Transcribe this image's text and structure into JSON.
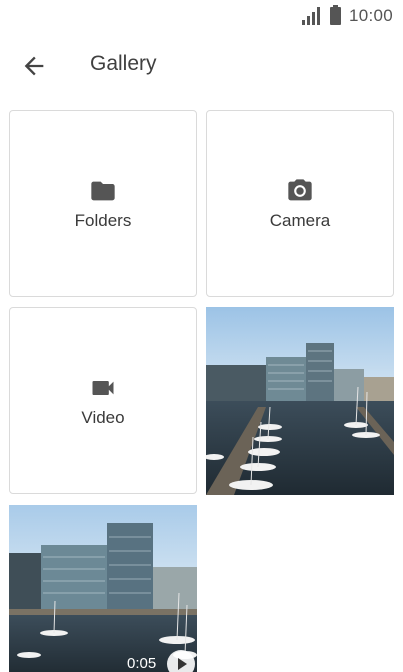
{
  "status_bar": {
    "time": "10:00",
    "signal_icon": "signal-icon",
    "battery_icon": "battery-icon"
  },
  "app_bar": {
    "title": "Gallery",
    "back_icon": "arrow-back-icon"
  },
  "tiles": [
    {
      "label": "Folders",
      "icon": "folder-icon"
    },
    {
      "label": "Camera",
      "icon": "camera-icon"
    },
    {
      "label": "Video",
      "icon": "videocam-icon"
    }
  ],
  "media": [
    {
      "kind": "photo",
      "description_icon": "photo-thumbnail"
    },
    {
      "kind": "video",
      "duration": "0:05",
      "badge_icon": "play-icon"
    }
  ],
  "colors": {
    "icon": "#555555",
    "tile_border": "#dadada",
    "sky": "#b9d6ee",
    "water": "#2a3a45"
  }
}
